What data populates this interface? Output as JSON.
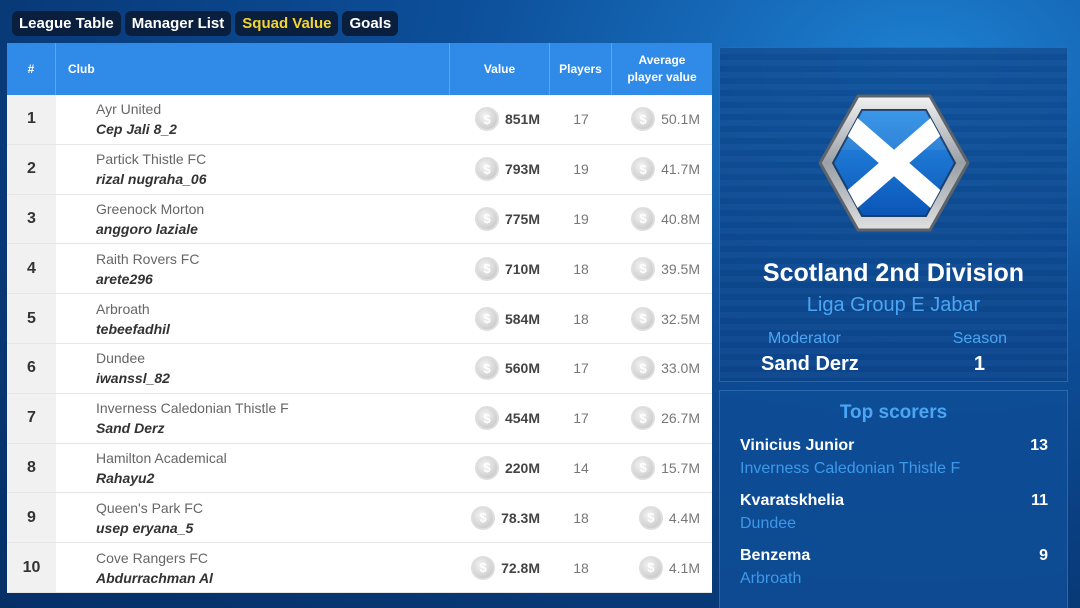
{
  "tabs": [
    {
      "label": "League Table",
      "active": false
    },
    {
      "label": "Manager List",
      "active": false
    },
    {
      "label": "Squad Value",
      "active": true
    },
    {
      "label": "Goals",
      "active": false
    }
  ],
  "table": {
    "headers": {
      "rank": "#",
      "club": "Club",
      "value": "Value",
      "players": "Players",
      "avg_line1": "Average",
      "avg_line2": "player value"
    },
    "coin_symbol": "$",
    "rows": [
      {
        "rank": "1",
        "club": "Ayr United",
        "manager": "Cep Jali 8_2",
        "value": "851M",
        "players": "17",
        "avg": "50.1M"
      },
      {
        "rank": "2",
        "club": "Partick Thistle FC",
        "manager": "rizal nugraha_06",
        "value": "793M",
        "players": "19",
        "avg": "41.7M"
      },
      {
        "rank": "3",
        "club": "Greenock Morton",
        "manager": "anggoro laziale",
        "value": "775M",
        "players": "19",
        "avg": "40.8M"
      },
      {
        "rank": "4",
        "club": "Raith Rovers FC",
        "manager": "arete296",
        "value": "710M",
        "players": "18",
        "avg": "39.5M"
      },
      {
        "rank": "5",
        "club": "Arbroath",
        "manager": "tebeefadhil",
        "value": "584M",
        "players": "18",
        "avg": "32.5M"
      },
      {
        "rank": "6",
        "club": "Dundee",
        "manager": "iwanssl_82",
        "value": "560M",
        "players": "17",
        "avg": "33.0M"
      },
      {
        "rank": "7",
        "club": "Inverness Caledonian Thistle F",
        "manager": "Sand Derz",
        "value": "454M",
        "players": "17",
        "avg": "26.7M"
      },
      {
        "rank": "8",
        "club": "Hamilton Academical",
        "manager": "Rahayu2",
        "value": "220M",
        "players": "14",
        "avg": "15.7M"
      },
      {
        "rank": "9",
        "club": "Queen's Park FC",
        "manager": "usep eryana_5",
        "value": "78.3M",
        "players": "18",
        "avg": "4.4M"
      },
      {
        "rank": "10",
        "club": "Cove Rangers FC",
        "manager": "Abdurrachman Al",
        "value": "72.8M",
        "players": "18",
        "avg": "4.1M"
      }
    ]
  },
  "league": {
    "title": "Scotland 2nd Division",
    "group": "Liga Group E Jabar",
    "moderator_label": "Moderator",
    "moderator": "Sand Derz",
    "season_label": "Season",
    "season": "1",
    "flag_icon": "scotland-saltire-icon"
  },
  "top_scorers": {
    "title": "Top scorers",
    "items": [
      {
        "name": "Vinicius Junior",
        "club": "Inverness Caledonian Thistle F",
        "goals": "13"
      },
      {
        "name": "Kvaratskhelia",
        "club": "Dundee",
        "goals": "11"
      },
      {
        "name": "Benzema",
        "club": "Arbroath",
        "goals": "9"
      }
    ]
  },
  "colors": {
    "header_blue": "#2f8ae8",
    "active_tab": "#f5d431",
    "accent_light_blue": "#4aa6f4"
  }
}
